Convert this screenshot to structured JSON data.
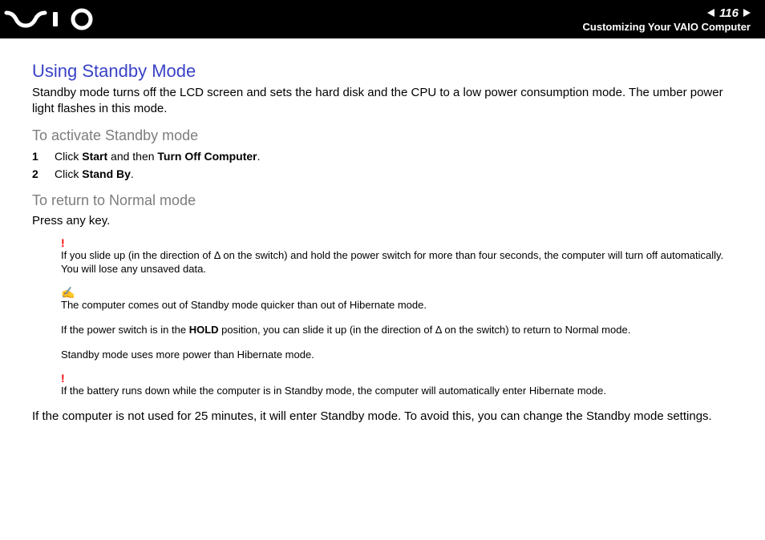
{
  "header": {
    "page_number": "116",
    "section": "Customizing Your VAIO Computer"
  },
  "title": "Using Standby Mode",
  "intro": "Standby mode turns off the LCD screen and sets the hard disk and the CPU to a low power consumption mode. The umber power light flashes in this mode.",
  "activate": {
    "heading": "To activate Standby mode",
    "steps": [
      {
        "n": "1",
        "pre": "Click ",
        "b1": "Start",
        "mid": " and then ",
        "b2": "Turn Off Computer",
        "post": "."
      },
      {
        "n": "2",
        "pre": "Click ",
        "b1": "Stand By",
        "mid": "",
        "b2": "",
        "post": "."
      }
    ]
  },
  "returnmode": {
    "heading": "To return to Normal mode",
    "body": "Press any key."
  },
  "notes": {
    "warn1": {
      "icon": "!",
      "text": "If you slide up (in the direction of Δ on the switch) and hold the power switch for more than four seconds, the computer will turn off automatically. You will lose any unsaved data."
    },
    "tip_icon": "✍",
    "tip_line1": "The computer comes out of Standby mode quicker than out of Hibernate mode.",
    "tip_line2_pre": "If the power switch is in the ",
    "tip_line2_bold": "HOLD",
    "tip_line2_post": " position, you can slide it up (in the direction of Δ on the switch) to return to Normal mode.",
    "tip_line3": "Standby mode uses more power than Hibernate mode.",
    "warn2": {
      "icon": "!",
      "text": "If the battery runs down while the computer is in Standby mode, the computer will automatically enter Hibernate mode."
    }
  },
  "closing": "If the computer is not used for 25 minutes, it will enter Standby mode. To avoid this, you can change the Standby mode settings."
}
